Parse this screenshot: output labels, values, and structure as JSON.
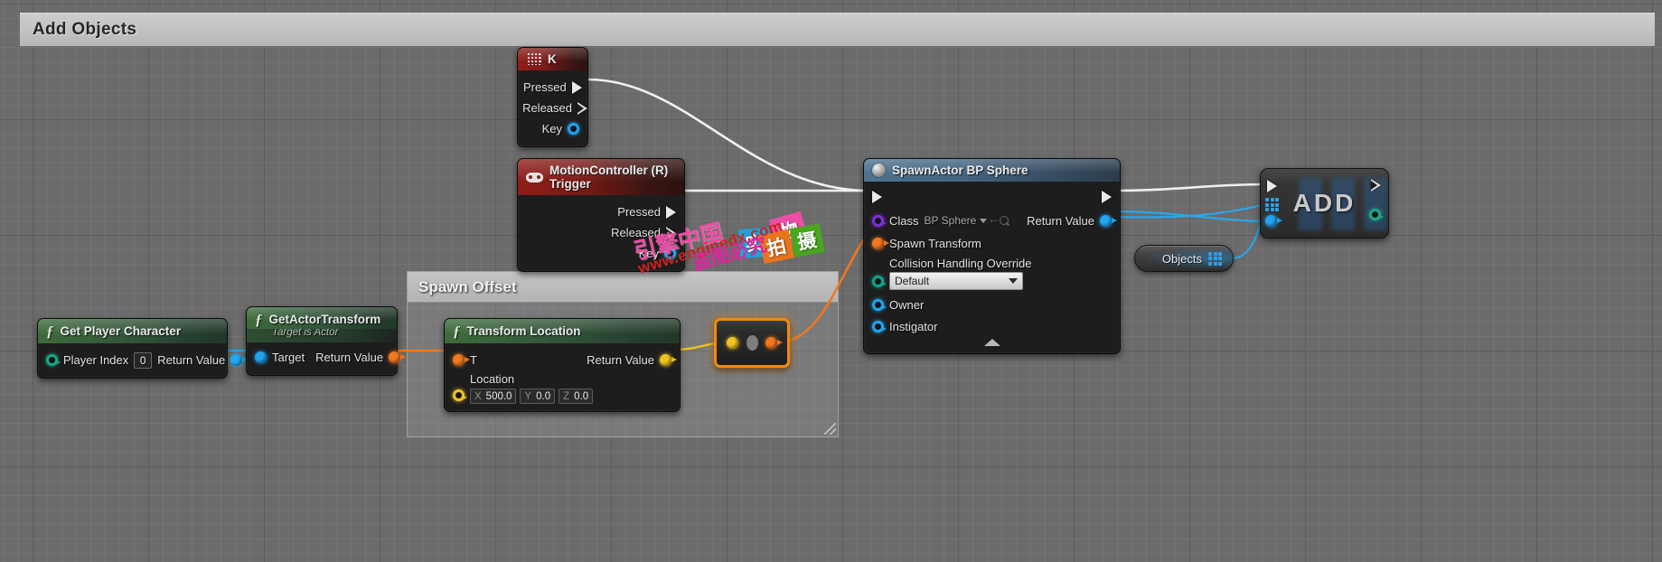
{
  "window": {
    "title": "Add Objects"
  },
  "comment": {
    "title": "Spawn Offset"
  },
  "nodes": {
    "key_event": {
      "title": "K",
      "icon": "keyboard-icon",
      "pins": [
        {
          "label": "Pressed",
          "kind": "exec-filled"
        },
        {
          "label": "Released",
          "kind": "exec-hollow"
        },
        {
          "label": "Key",
          "kind": "data-blue"
        }
      ]
    },
    "motion_event": {
      "title": "MotionController (R) Trigger",
      "icon": "gamepad-icon",
      "pins": [
        {
          "label": "Pressed",
          "kind": "exec-filled"
        },
        {
          "label": "Released",
          "kind": "exec-hollow"
        },
        {
          "label": "Key",
          "kind": "data-blue"
        }
      ]
    },
    "spawn_actor": {
      "title": "SpawnActor BP Sphere",
      "icon": "sphere-icon",
      "class_label": "Class",
      "class_value": "BP Sphere",
      "spawn_transform_label": "Spawn Transform",
      "collision_label": "Collision Handling Override",
      "collision_value": "Default",
      "owner_label": "Owner",
      "instigator_label": "Instigator",
      "return_label": "Return Value"
    },
    "get_player_character": {
      "title": "Get Player Character",
      "player_index_label": "Player Index",
      "player_index_value": "0",
      "return_label": "Return Value"
    },
    "get_actor_transform": {
      "title": "GetActorTransform",
      "subtitle": "Target is Actor",
      "target_label": "Target",
      "return_label": "Return Value"
    },
    "transform_location": {
      "title": "Transform Location",
      "t_label": "T",
      "location_label": "Location",
      "x_axis": "X",
      "x_value": "500.0",
      "y_axis": "Y",
      "y_value": "0.0",
      "z_axis": "Z",
      "z_value": "0.0",
      "return_label": "Return Value"
    },
    "objects_pill": {
      "label": "Objects",
      "icon": "array-grid-icon"
    },
    "add_node": {
      "label": "ADD"
    }
  },
  "colors": {
    "exec_white": "#e9e9e9",
    "object_blue": "#1fa3ee",
    "transform_orange": "#f07820",
    "vector_yellow": "#eec423",
    "class_purple": "#7a2fd6",
    "int_green": "#1aa58a",
    "selection_orange": "#f08a12",
    "event_red": "#8e1d18",
    "function_green": "#3d6b3c",
    "canvas_gray": "#6b6b6b"
  },
  "watermarks": {
    "brand": "引擎中国",
    "site": "www.enginedx.com",
    "notice": "盗图必究",
    "blocks": [
      {
        "text": "实",
        "color": "#1fa0d8"
      },
      {
        "text": "物",
        "color": "#ec4fa6"
      },
      {
        "text": "拍",
        "color": "#e8751d"
      },
      {
        "text": "摄",
        "color": "#4aa51f"
      }
    ]
  }
}
